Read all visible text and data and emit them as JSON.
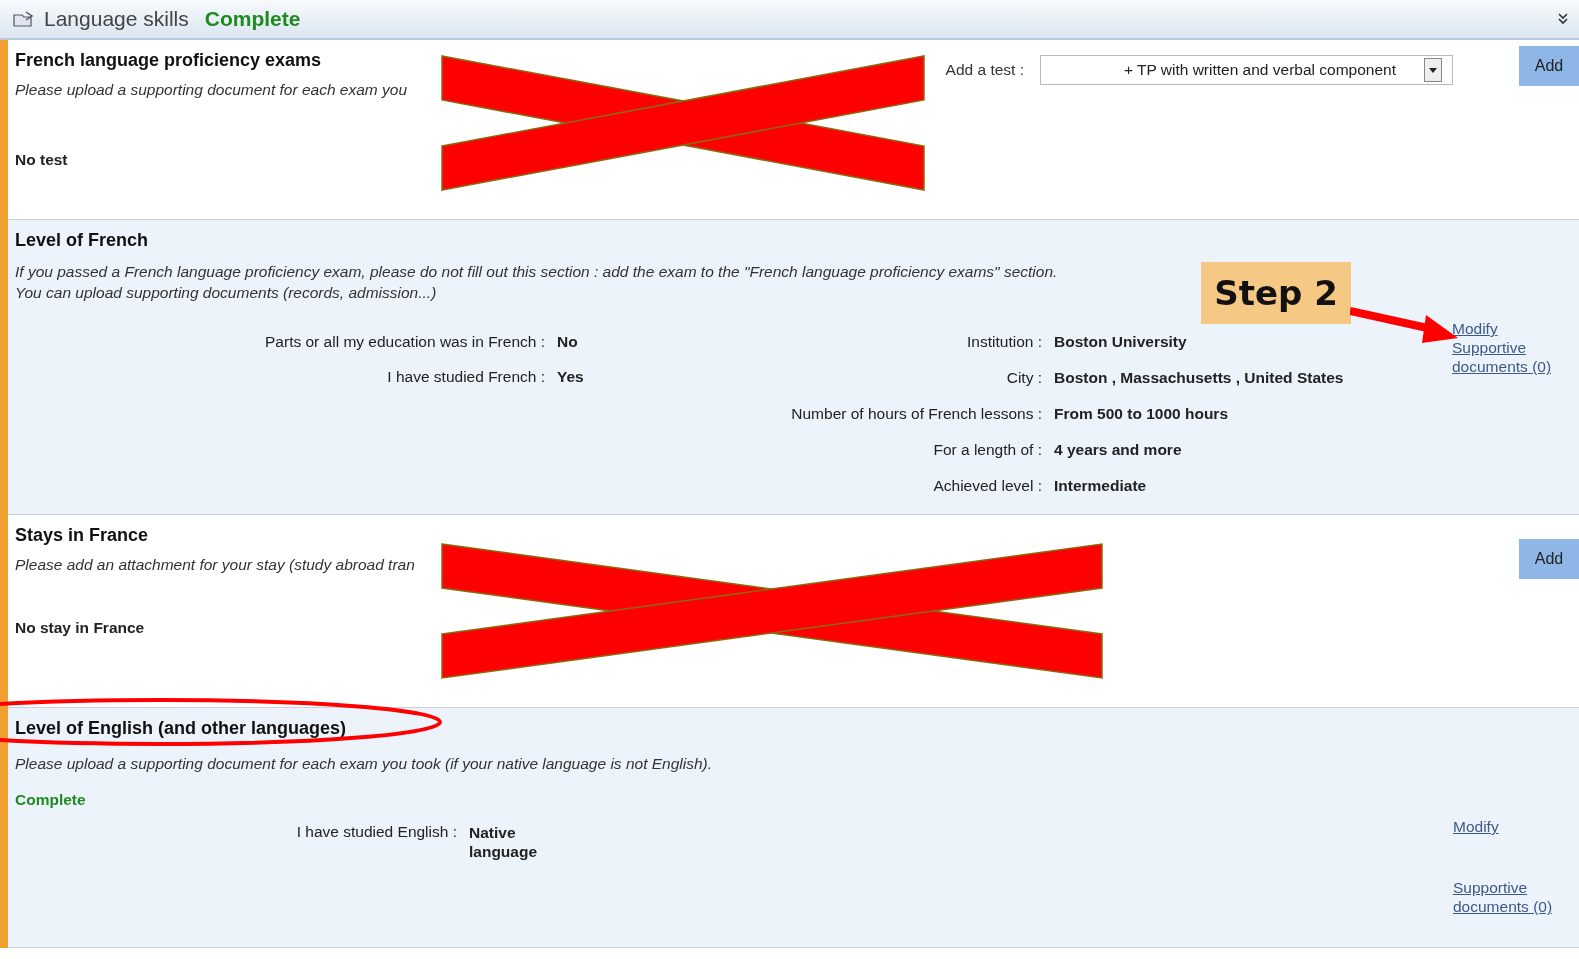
{
  "header": {
    "title": "Language skills",
    "status": "Complete"
  },
  "french_exams": {
    "title": "French language proficiency exams",
    "note": "Please upload a supporting document for each exam you",
    "add_test_label": "Add a test :",
    "test_select": "+ TP with written and verbal component",
    "add_button": "Add",
    "empty_text": "No test"
  },
  "level_of_french": {
    "title": "Level of French",
    "note_lines": [
      "If you passed a French language proficiency exam, please do not fill out this section : add the exam to the \"French language proficiency exams\" section.",
      "You can upload supporting documents (records, admission...)"
    ],
    "left_fields": [
      {
        "label": "Parts or all my education was in French :",
        "value": "No"
      },
      {
        "label": "I have studied French :",
        "value": "Yes"
      }
    ],
    "right_fields": [
      {
        "label": "Institution :",
        "value": "Boston University"
      },
      {
        "label": "City :",
        "value": "Boston , Massachusetts , United States"
      },
      {
        "label": "Number of hours of French lessons :",
        "value": "From 500 to 1000 hours"
      },
      {
        "label": "For a length of :",
        "value": "4 years and more"
      },
      {
        "label": "Achieved level :",
        "value": "Intermediate"
      }
    ],
    "links": [
      "Modify",
      "Supportive documents (0)"
    ]
  },
  "stays": {
    "title": "Stays in France",
    "note": "Please add an attachment for your stay (study abroad tran",
    "add_button": "Add",
    "empty_text": "No stay in France"
  },
  "level_of_english": {
    "title": "Level of English (and other languages)",
    "note": "Please upload a supporting document for each exam you took (if your native language is not English).",
    "status": "Complete",
    "fields": [
      {
        "label": "I have studied English :",
        "value": "Native language"
      }
    ],
    "links": [
      "Modify",
      "Supportive documents (0)"
    ]
  },
  "annotations": {
    "callout": "Step 2"
  }
}
